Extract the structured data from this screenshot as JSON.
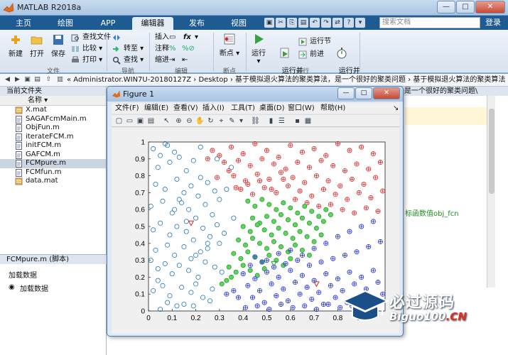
{
  "window": {
    "title": "MATLAB R2018a",
    "controls": [
      "—",
      "□",
      "✕"
    ]
  },
  "ribbon_tabs": [
    {
      "label": "主页",
      "active": false
    },
    {
      "label": "绘图",
      "active": false
    },
    {
      "label": "APP",
      "active": false
    },
    {
      "label": "编辑器",
      "active": true
    },
    {
      "label": "发布",
      "active": false
    },
    {
      "label": "视图",
      "active": false
    }
  ],
  "search_placeholder": "搜索文档",
  "login_label": "登录",
  "ribbon": {
    "file": {
      "new": "新建",
      "open": "打开",
      "save": "保存",
      "find_files": "查找文件",
      "compare": "比较",
      "print": "打印",
      "group": "文件"
    },
    "navigate": {
      "goto": "转至",
      "find": "查找",
      "group": "导航"
    },
    "edit": {
      "insert": "插入",
      "comment": "注释",
      "indent": "缩进",
      "fx": "fx",
      "group": "编辑"
    },
    "breakpoints": {
      "breakpoint": "断点",
      "group": "断点"
    },
    "run": {
      "run": "运行",
      "run_advance": "运行并\n前进",
      "run_section": "运行节",
      "advance": "前进",
      "run_time": "运行并\n计时",
      "group": "运行"
    }
  },
  "address_bar": {
    "path": "« Administrator.WIN7U-20180127Z  ›  Desktop  ›  基于模拟退火算法的聚类算法，是一个很好的聚类问题  ›  基于模拟退火算法的聚类算法  ›"
  },
  "current_folder": {
    "title": "当前文件夹",
    "column": "名称 ▾",
    "files": [
      {
        "name": "X.mat",
        "type": "mat",
        "selected": false
      },
      {
        "name": "SAGAFcmMain.m",
        "type": "m",
        "selected": false
      },
      {
        "name": "ObjFun.m",
        "type": "m",
        "selected": false
      },
      {
        "name": "iterateFCM.m",
        "type": "m",
        "selected": false
      },
      {
        "name": "initFCM.m",
        "type": "m",
        "selected": false
      },
      {
        "name": "GAFCM.m",
        "type": "m",
        "selected": false
      },
      {
        "name": "FCMpure.m",
        "type": "m",
        "selected": true
      },
      {
        "name": "FCMfun.m",
        "type": "m",
        "selected": false
      },
      {
        "name": "data.mat",
        "type": "mat",
        "selected": false
      }
    ]
  },
  "details": {
    "title": "FCMpure.m  (脚本)",
    "line1": "加载数据",
    "line2": "加载数据"
  },
  "editor": {
    "tab_text": "是一个很好的聚类问题\\",
    "comment": "标函数值obj_fcn"
  },
  "figure": {
    "title": "Figure 1",
    "menu": [
      "文件(F)",
      "编辑(E)",
      "查看(V)",
      "插入(I)",
      "工具(T)",
      "桌面(D)",
      "窗口(W)",
      "帮助(H)"
    ],
    "toolbar_icons": [
      "new-figure-icon",
      "open-icon",
      "save-icon",
      "print-icon",
      "pointer-icon",
      "zoom-in-icon",
      "zoom-out-icon",
      "pan-icon",
      "rotate-icon",
      "data-cursor-icon",
      "brush-icon",
      "link-icon",
      "colorbar-icon",
      "legend-icon",
      "hide-plot-tools-icon",
      "show-plot-tools-icon"
    ]
  },
  "chart_data": {
    "type": "scatter",
    "xlim": [
      0,
      1
    ],
    "ylim": [
      0,
      1
    ],
    "xticks": [
      0,
      0.1,
      0.2,
      0.3,
      0.4,
      0.5,
      0.6,
      0.7,
      0.8,
      0.9
    ],
    "yticks": [
      0,
      0.1,
      0.2,
      0.3,
      0.4,
      0.5,
      0.6,
      0.7,
      0.8,
      0.9,
      1
    ],
    "grid": false,
    "series": [
      {
        "marker": "o-open",
        "color": "#1f77b4",
        "x": [
          0.02,
          0.05,
          0.08,
          0.11,
          0.04,
          0.09,
          0.13,
          0.16,
          0.19,
          0.22,
          0.03,
          0.07,
          0.12,
          0.15,
          0.18,
          0.21,
          0.25,
          0.28,
          0.01,
          0.06,
          0.1,
          0.14,
          0.17,
          0.2,
          0.24,
          0.27,
          0.3,
          0.02,
          0.05,
          0.09,
          0.12,
          0.16,
          0.19,
          0.23,
          0.26,
          0.29,
          0.32,
          0.03,
          0.08,
          0.11,
          0.15,
          0.18,
          0.22,
          0.25,
          0.04,
          0.07,
          0.1,
          0.13,
          0.17,
          0.21,
          0.24,
          0.28,
          0.31,
          0.02,
          0.06,
          0.09,
          0.14,
          0.18,
          0.2,
          0.23,
          0.12,
          0.08,
          0.05,
          0.15,
          0.26,
          0.01,
          0.11,
          0.19,
          0.27,
          0.35,
          0.33,
          0.3,
          0.36,
          0.04,
          0.16,
          0.22,
          0.29,
          0.07,
          0.13,
          0.2,
          0.25
        ],
        "y": [
          0.96,
          0.92,
          0.98,
          0.94,
          0.85,
          0.88,
          0.91,
          0.83,
          0.89,
          0.79,
          0.75,
          0.72,
          0.78,
          0.7,
          0.74,
          0.68,
          0.76,
          0.71,
          0.62,
          0.65,
          0.58,
          0.64,
          0.6,
          0.55,
          0.63,
          0.57,
          0.66,
          0.48,
          0.52,
          0.45,
          0.5,
          0.47,
          0.42,
          0.49,
          0.44,
          0.51,
          0.46,
          0.36,
          0.39,
          0.33,
          0.38,
          0.31,
          0.35,
          0.4,
          0.25,
          0.28,
          0.22,
          0.27,
          0.24,
          0.2,
          0.29,
          0.26,
          0.23,
          0.12,
          0.15,
          0.09,
          0.14,
          0.11,
          0.16,
          0.08,
          0.03,
          0.05,
          0.01,
          0.04,
          0.06,
          0.3,
          0.6,
          0.03,
          0.13,
          0.85,
          0.72,
          0.4,
          0.55,
          0.18,
          0.53,
          0.97,
          0.9,
          0.99,
          0.66,
          0.33,
          0.37
        ]
      },
      {
        "marker": "o-plus",
        "color": "#d62728",
        "x": [
          0.35,
          0.4,
          0.45,
          0.5,
          0.55,
          0.6,
          0.65,
          0.7,
          0.75,
          0.8,
          0.85,
          0.9,
          0.95,
          0.38,
          0.43,
          0.48,
          0.53,
          0.58,
          0.63,
          0.68,
          0.73,
          0.78,
          0.83,
          0.88,
          0.93,
          0.98,
          0.36,
          0.41,
          0.46,
          0.51,
          0.56,
          0.61,
          0.66,
          0.71,
          0.76,
          0.81,
          0.86,
          0.91,
          0.96,
          0.39,
          0.44,
          0.49,
          0.54,
          0.59,
          0.64,
          0.69,
          0.74,
          0.79,
          0.84,
          0.89,
          0.94,
          0.99,
          0.37,
          0.42,
          0.47,
          0.52,
          0.57,
          0.62,
          0.67,
          0.72,
          0.77,
          0.82,
          0.87,
          0.92,
          0.97,
          0.34,
          0.32,
          0.3,
          0.27,
          0.25,
          0.29
        ],
        "y": [
          0.97,
          0.93,
          0.99,
          0.95,
          0.91,
          0.98,
          0.94,
          0.96,
          0.92,
          0.99,
          0.95,
          0.97,
          0.93,
          0.89,
          0.86,
          0.9,
          0.87,
          0.84,
          0.88,
          0.85,
          0.89,
          0.86,
          0.83,
          0.87,
          0.84,
          0.88,
          0.8,
          0.77,
          0.81,
          0.78,
          0.82,
          0.79,
          0.76,
          0.8,
          0.77,
          0.74,
          0.78,
          0.75,
          0.79,
          0.72,
          0.69,
          0.73,
          0.7,
          0.74,
          0.71,
          0.68,
          0.72,
          0.69,
          0.66,
          0.7,
          0.67,
          0.71,
          0.73,
          0.75,
          0.77,
          0.72,
          0.78,
          0.66,
          0.64,
          0.62,
          0.63,
          0.6,
          0.58,
          0.61,
          0.59,
          0.83,
          0.88,
          0.92,
          0.95,
          0.9,
          0.79
        ]
      },
      {
        "marker": "o-filled-green",
        "color": "#2ca02c",
        "x": [
          0.42,
          0.45,
          0.48,
          0.51,
          0.54,
          0.57,
          0.6,
          0.63,
          0.66,
          0.69,
          0.72,
          0.75,
          0.44,
          0.47,
          0.5,
          0.53,
          0.56,
          0.59,
          0.62,
          0.65,
          0.68,
          0.71,
          0.74,
          0.4,
          0.43,
          0.46,
          0.49,
          0.52,
          0.55,
          0.58,
          0.61,
          0.64,
          0.67,
          0.7,
          0.73,
          0.38,
          0.41,
          0.44,
          0.47,
          0.5,
          0.53,
          0.56,
          0.59,
          0.62,
          0.65,
          0.68,
          0.36,
          0.39,
          0.42,
          0.45,
          0.48,
          0.51,
          0.54,
          0.57,
          0.6,
          0.34,
          0.37,
          0.4,
          0.43,
          0.46,
          0.49,
          0.33,
          0.35,
          0.31,
          0.77
        ],
        "y": [
          0.65,
          0.62,
          0.66,
          0.63,
          0.6,
          0.64,
          0.61,
          0.58,
          0.62,
          0.59,
          0.56,
          0.6,
          0.55,
          0.52,
          0.56,
          0.53,
          0.57,
          0.54,
          0.51,
          0.55,
          0.52,
          0.49,
          0.53,
          0.5,
          0.47,
          0.51,
          0.48,
          0.45,
          0.49,
          0.46,
          0.43,
          0.47,
          0.44,
          0.41,
          0.45,
          0.42,
          0.39,
          0.43,
          0.4,
          0.37,
          0.41,
          0.38,
          0.35,
          0.39,
          0.36,
          0.33,
          0.34,
          0.31,
          0.35,
          0.32,
          0.29,
          0.33,
          0.3,
          0.27,
          0.31,
          0.26,
          0.23,
          0.27,
          0.24,
          0.21,
          0.25,
          0.18,
          0.2,
          0.16,
          0.57
        ]
      },
      {
        "marker": "o-plus-blue",
        "color": "#1f30d6",
        "x": [
          0.4,
          0.45,
          0.5,
          0.55,
          0.6,
          0.65,
          0.7,
          0.75,
          0.8,
          0.85,
          0.9,
          0.95,
          0.42,
          0.47,
          0.52,
          0.57,
          0.62,
          0.67,
          0.72,
          0.77,
          0.82,
          0.87,
          0.92,
          0.97,
          0.44,
          0.49,
          0.54,
          0.59,
          0.64,
          0.69,
          0.74,
          0.79,
          0.84,
          0.89,
          0.94,
          0.99,
          0.41,
          0.46,
          0.51,
          0.56,
          0.61,
          0.66,
          0.71,
          0.76,
          0.81,
          0.86,
          0.91,
          0.96,
          0.43,
          0.48,
          0.53,
          0.58,
          0.63,
          0.68,
          0.73,
          0.78,
          0.83,
          0.88,
          0.93,
          0.98,
          0.45,
          0.5,
          0.55,
          0.6,
          0.65,
          0.7,
          0.75,
          0.8,
          0.85,
          0.9,
          0.95,
          0.36,
          0.38,
          0.33
        ],
        "y": [
          0.22,
          0.19,
          0.23,
          0.2,
          0.24,
          0.21,
          0.18,
          0.22,
          0.19,
          0.23,
          0.2,
          0.24,
          0.15,
          0.12,
          0.16,
          0.13,
          0.17,
          0.14,
          0.11,
          0.15,
          0.12,
          0.16,
          0.13,
          0.17,
          0.08,
          0.05,
          0.09,
          0.06,
          0.1,
          0.07,
          0.04,
          0.08,
          0.05,
          0.09,
          0.06,
          0.1,
          0.02,
          0.03,
          0.01,
          0.04,
          0.02,
          0.03,
          0.01,
          0.04,
          0.02,
          0.03,
          0.01,
          0.04,
          0.27,
          0.29,
          0.26,
          0.28,
          0.3,
          0.27,
          0.29,
          0.31,
          0.33,
          0.35,
          0.38,
          0.41,
          0.32,
          0.3,
          0.34,
          0.36,
          0.33,
          0.37,
          0.4,
          0.44,
          0.47,
          0.5,
          0.53,
          0.12,
          0.08,
          0.1
        ]
      }
    ],
    "centroids": [
      {
        "x": 0.18,
        "y": 0.52,
        "color": "#d62728",
        "marker": "triangle-down"
      },
      {
        "x": 0.53,
        "y": 0.28,
        "color": "#2ca02c",
        "marker": "triangle-down"
      },
      {
        "x": 0.71,
        "y": 0.16,
        "color": "#d62728",
        "marker": "triangle-down"
      }
    ]
  },
  "watermark": {
    "big": "必过源码",
    "small_main": "Biguo100",
    "small_suffix": ".CN"
  }
}
